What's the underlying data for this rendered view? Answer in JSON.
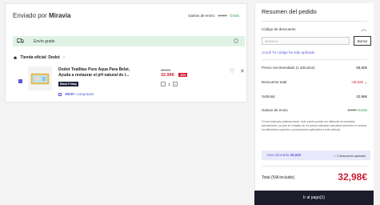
{
  "shipment": {
    "heading_prefix": "Enviado por",
    "heading_seller": "Miravia",
    "shipping_label": "Gastos de envío:",
    "shipping_old": "3,99€",
    "shipping_new": "Gratis"
  },
  "free_shipping": {
    "label": "Envío gratis"
  },
  "store": {
    "label": "Tienda oficial:",
    "name": "Dodot"
  },
  "product": {
    "name": "Dodot Toallitas Pure Aqua Para Bebé, Ayuda a restaurar el pH natural de l...",
    "badge": "Black Friday",
    "old_price": "68,50€",
    "new_price": "32,96€",
    "discount": "-52%",
    "quantity": "1",
    "qty_minus": "-",
    "qty_plus": "+",
    "sold_count": "5000+",
    "sold_suffix": "comprados"
  },
  "summary": {
    "title": "Resumen del pedido",
    "coupon_label": "Código de descuento",
    "coupon_placeholder": "MIRAVIA",
    "apply_button": "Borrar",
    "coupon_link": "¡Cool! Tu código ha sido aplicado",
    "rows": [
      {
        "label": "Precio recomendado (1 artículos)",
        "value": "68,50€"
      },
      {
        "label": "Descuento total",
        "value": "-35,52€"
      },
      {
        "label": "Subtotal",
        "value": "32,96€"
      },
      {
        "label": "Gastos de envío",
        "old": "3,99€",
        "value": "Gratis"
      }
    ],
    "note": "*Como indicado anteriormente, este precio puede ser diferente al mostrado previamente, ya que se instalas de un precio estimado calculado teniendo en cuenta los diferentes cupones y promociones aplicables a este artículo.",
    "saved_prefix": "Has ahorrado",
    "saved_amount": "35,52€",
    "discounts_applied": "✓ 2 descuento aplicado",
    "total_label": "Total (IVA incluido)",
    "total_value": "32,98€",
    "pay_button": "Ir al pago(1)"
  },
  "colors": {
    "accent": "#5b5bd6",
    "price_red": "#d01d35",
    "green": "#2a9d4b",
    "free_bg": "#dff3e4",
    "pay_bg": "#1c1c2b"
  }
}
